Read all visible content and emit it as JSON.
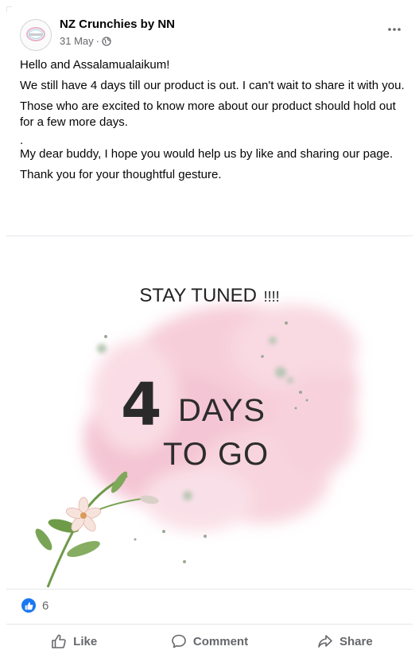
{
  "post": {
    "page_name": "NZ Crunchies by NN",
    "date": "31 May",
    "separator": "·",
    "privacy_icon": "globe-icon",
    "more_icon": "more-options-icon",
    "paragraphs": [
      "Hello and Assalamualaikum!",
      "We still have 4 days till our product is out. I can't wait to share it with you.",
      "Those who are excited to know more about our product should hold out for a few more days.",
      ".",
      "My dear buddy, I hope you would help us by like and sharing our page.",
      "Thank you for your thoughtful gesture."
    ]
  },
  "image": {
    "headline": "STAY TUNED",
    "headline_marks": "!!!!",
    "number": "4",
    "line1": "DAYS",
    "line2": "TO GO",
    "colors": {
      "watercolor": "#f4c6d3",
      "splatter": "#b9c7b5",
      "text": "#2c2c2c"
    }
  },
  "reactions": {
    "count": "6",
    "icon": "like-reaction-icon"
  },
  "actions": {
    "like": {
      "label": "Like",
      "icon": "thumbs-up-icon"
    },
    "comment": {
      "label": "Comment",
      "icon": "comment-bubble-icon"
    },
    "share": {
      "label": "Share",
      "icon": "share-arrow-icon"
    }
  },
  "colors": {
    "accent": "#1877f2",
    "secondary_text": "#65676b",
    "divider": "#e4e6eb"
  }
}
